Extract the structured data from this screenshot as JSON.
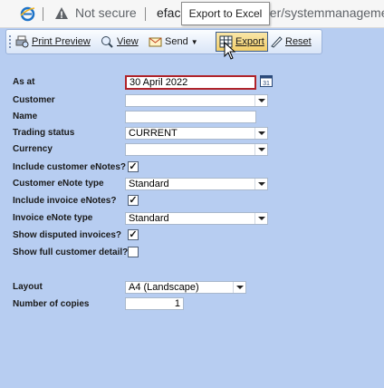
{
  "browser": {
    "security_text": "Not secure",
    "url_part1": "efac",
    "url_part2": "ger/systemmanageme",
    "tooltip": "Export to Excel"
  },
  "toolbar": {
    "print_preview": "Print Preview",
    "view": "View",
    "send": "Send",
    "export": "Export",
    "reset": "Reset"
  },
  "form": {
    "as_at": {
      "label": "As at",
      "value": "30 April 2022"
    },
    "customer": {
      "label": "Customer",
      "value": ""
    },
    "name": {
      "label": "Name",
      "value": ""
    },
    "trading_status": {
      "label": "Trading status",
      "value": "CURRENT"
    },
    "currency": {
      "label": "Currency",
      "value": ""
    },
    "include_customer_enotes": {
      "label": "Include customer eNotes?",
      "checked": true
    },
    "customer_enote_type": {
      "label": "Customer eNote type",
      "value": "Standard"
    },
    "include_invoice_enotes": {
      "label": "Include invoice eNotes?",
      "checked": true
    },
    "invoice_enote_type": {
      "label": "Invoice eNote type",
      "value": "Standard"
    },
    "show_disputed_invoices": {
      "label": "Show disputed invoices?",
      "checked": true
    },
    "show_full_customer_detail": {
      "label": "Show full customer detail?",
      "checked": false
    },
    "layout": {
      "label": "Layout",
      "value": "A4 (Landscape)"
    },
    "number_of_copies": {
      "label": "Number of copies",
      "value": "1"
    }
  },
  "colors": {
    "panel_bg": "#b7cdf1",
    "as_at_border": "#b0232a"
  }
}
